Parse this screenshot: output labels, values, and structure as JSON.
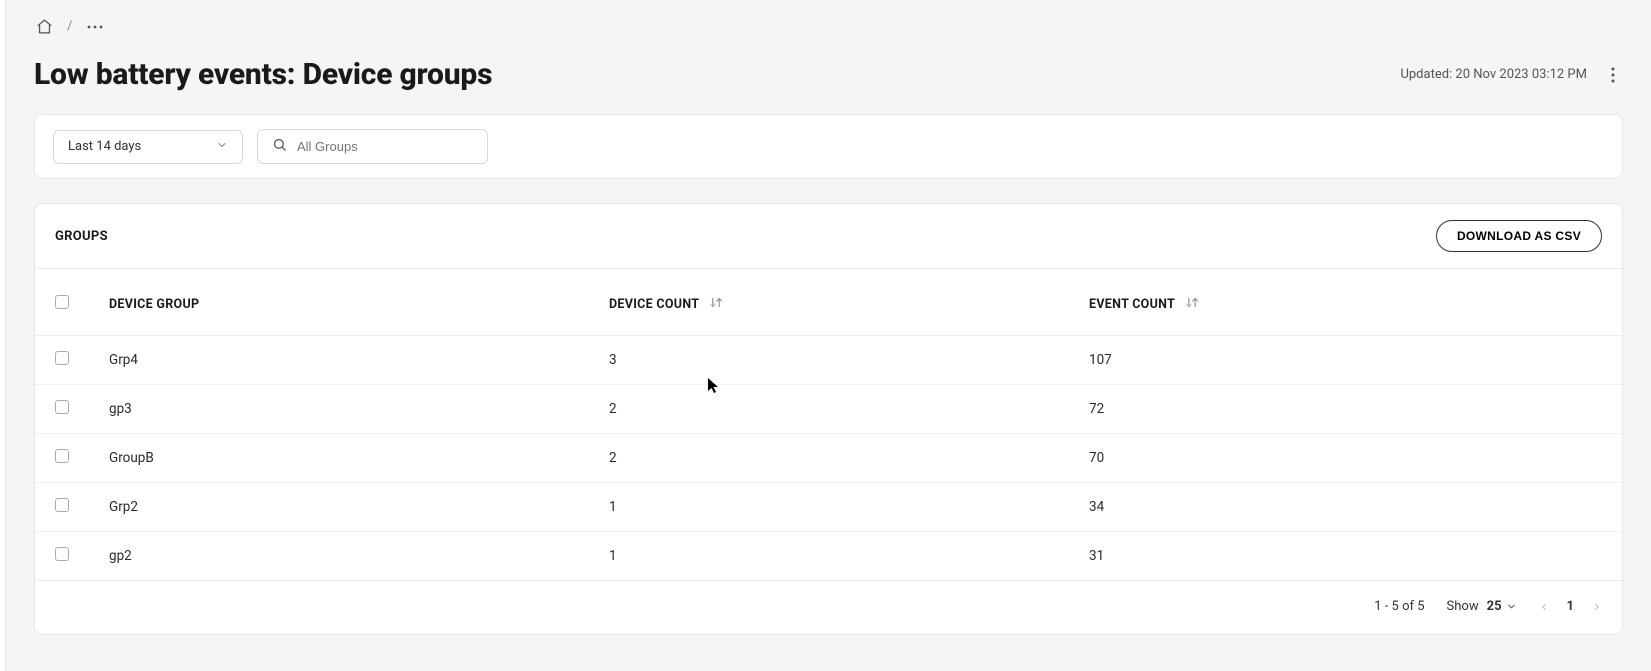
{
  "breadcrumb": {
    "separator": "/"
  },
  "header": {
    "title": "Low battery events: Device groups",
    "updated": "Updated: 20 Nov 2023 03:12 PM"
  },
  "filters": {
    "range": "Last 14 days",
    "search_placeholder": "All Groups"
  },
  "table": {
    "card_title": "GROUPS",
    "download_label": "DOWNLOAD AS CSV",
    "columns": {
      "group": "DEVICE GROUP",
      "deviceCount": "DEVICE COUNT",
      "eventCount": "EVENT COUNT"
    },
    "rows": [
      {
        "name": "Grp4",
        "deviceCount": "3",
        "eventCount": "107"
      },
      {
        "name": "gp3",
        "deviceCount": "2",
        "eventCount": "72"
      },
      {
        "name": "GroupB",
        "deviceCount": "2",
        "eventCount": "70"
      },
      {
        "name": "Grp2",
        "deviceCount": "1",
        "eventCount": "34"
      },
      {
        "name": "gp2",
        "deviceCount": "1",
        "eventCount": "31"
      }
    ]
  },
  "pagination": {
    "range": "1 - 5 of 5",
    "show_label": "Show",
    "page_size": "25",
    "current_page": "1"
  }
}
